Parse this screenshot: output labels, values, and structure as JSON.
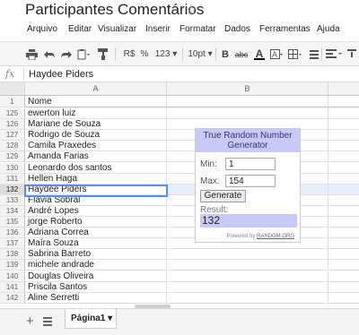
{
  "app": {
    "title": "Participantes Comentários",
    "star": "☆"
  },
  "menu": {
    "items": [
      "Arquivo",
      "Editar",
      "Visualizar",
      "Inserir",
      "Formatar",
      "Dados",
      "Ferramentas",
      "Ajuda"
    ]
  },
  "toolbar": {
    "currency": "R$",
    "percent": "%",
    "number_format": "123 ▾",
    "font_size": "10pt ▾",
    "bold": "B",
    "strike": "abc",
    "text_color": "A",
    "text_color_value": "#000000"
  },
  "formula_bar": {
    "fx": "fx",
    "value": "Haydee Piders"
  },
  "grid": {
    "columns": [
      "A",
      "B"
    ],
    "header_row": {
      "number": "1",
      "value": "Nome"
    },
    "rows": [
      {
        "number": "125",
        "value": "ewerton luiz"
      },
      {
        "number": "126",
        "value": "Mariane de Souza"
      },
      {
        "number": "127",
        "value": "Rodrigo de Souza"
      },
      {
        "number": "128",
        "value": "Camila Praxedes"
      },
      {
        "number": "129",
        "value": "Amanda Farias"
      },
      {
        "number": "130",
        "value": "Leonardo dos santos"
      },
      {
        "number": "131",
        "value": "Hellen Haga"
      },
      {
        "number": "132",
        "value": "Haydee Piders"
      },
      {
        "number": "133",
        "value": "Flávia Sobral"
      },
      {
        "number": "134",
        "value": "André Lopes"
      },
      {
        "number": "135",
        "value": "jorge Roberto"
      },
      {
        "number": "136",
        "value": "Adriana Correa"
      },
      {
        "number": "137",
        "value": "Maíra Souza"
      },
      {
        "number": "138",
        "value": "Sabrina Barreto"
      },
      {
        "number": "139",
        "value": "michele andrade"
      },
      {
        "number": "140",
        "value": "Douglas Oliveira"
      },
      {
        "number": "141",
        "value": "Priscila Santos"
      },
      {
        "number": "142",
        "value": "Aline Serretti"
      }
    ],
    "selected_row": "132"
  },
  "gadget": {
    "title": "True Random Number Generator",
    "min_label": "Min:",
    "min_value": "1",
    "max_label": "Max:",
    "max_value": "154",
    "button_label": "Generate",
    "result_label": "Result:",
    "result_value": "132",
    "powered_prefix": "Powered by",
    "powered_link": "RANDOM.ORG",
    "header_color": "#c9c9f7"
  },
  "sheets": {
    "add_label": "+",
    "tabs": [
      {
        "label": "Página1 ▾"
      }
    ]
  },
  "colors": {
    "selection_border": "#4d90fe",
    "row_highlight": "#e8eefb"
  }
}
